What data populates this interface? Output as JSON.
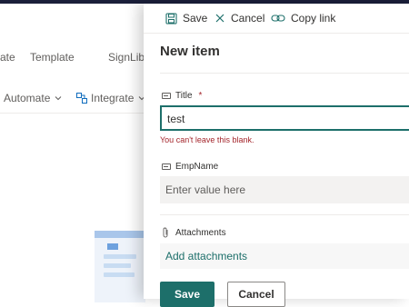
{
  "background": {
    "nav": {
      "partial_left": "ate",
      "template": "Template",
      "partial_right": "SignLibr"
    },
    "commands": {
      "automate": "Automate",
      "integrate": "Integrate"
    }
  },
  "panel": {
    "commandbar": {
      "save": "Save",
      "cancel": "Cancel",
      "copy_link": "Copy link"
    },
    "title": "New item",
    "fields": {
      "title": {
        "label": "Title",
        "required_mark": "*",
        "value": "test",
        "error": "You can't leave this blank."
      },
      "empname": {
        "label": "EmpName",
        "placeholder": "Enter value here"
      },
      "attachments": {
        "label": "Attachments",
        "action": "Add attachments"
      }
    },
    "buttons": {
      "save": "Save",
      "cancel": "Cancel"
    }
  },
  "colors": {
    "accent": "#1d6f6a",
    "error": "#a4262c",
    "topbar": "#1b1f3a"
  }
}
